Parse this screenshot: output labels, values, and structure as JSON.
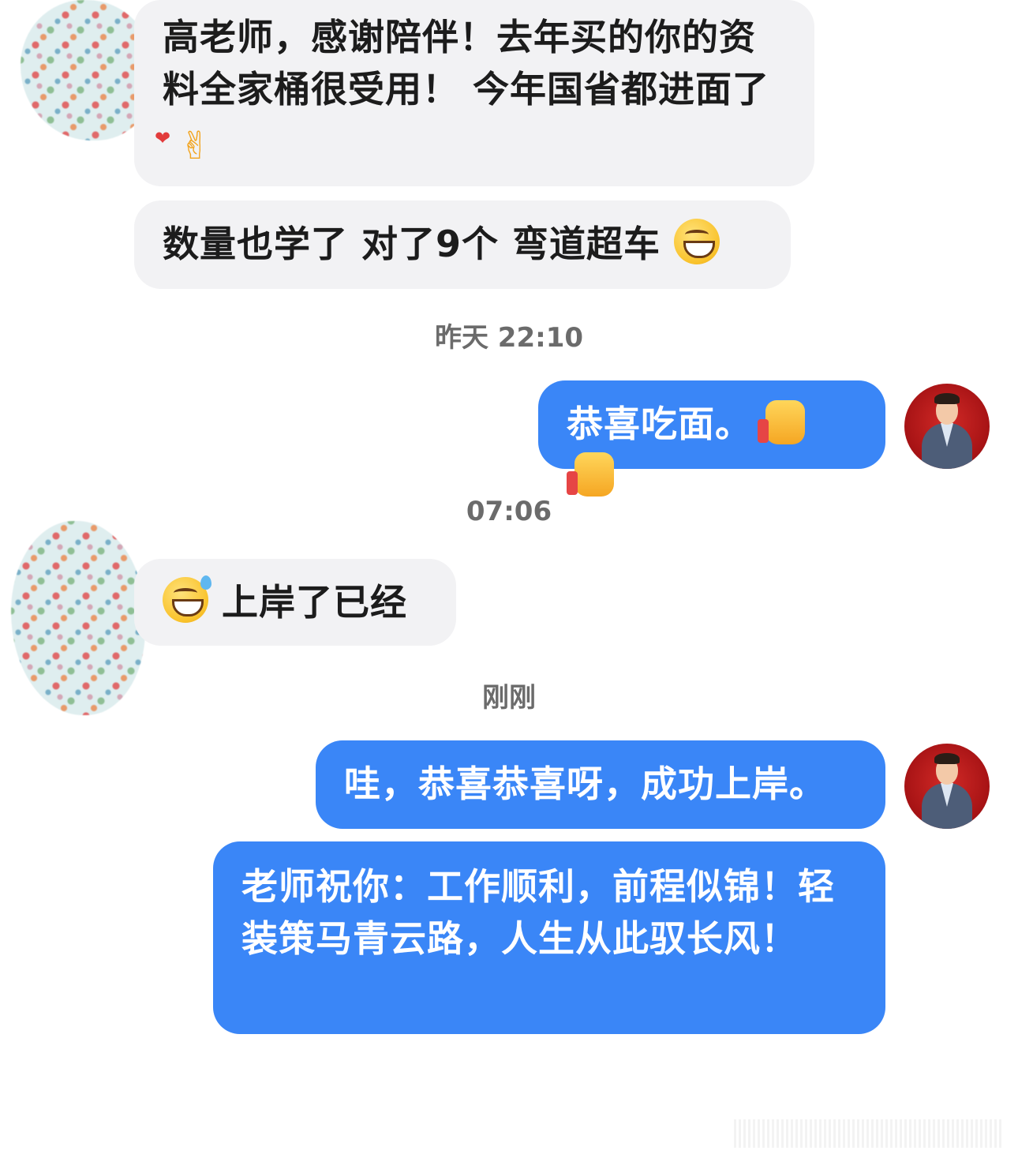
{
  "messages": [
    {
      "from": "student",
      "text": "高老师，感谢陪伴！去年买的你的资料全家桶很受用！ 今年国省都进面了",
      "emoji": "heart-hands-emoji"
    },
    {
      "from": "student",
      "text": "数量也学了 对了9个 弯道超车",
      "emoji": "grin-emoji"
    },
    {
      "from": "teacher",
      "text": "恭喜吃面。",
      "emoji": "thumbs-up-emoji x2"
    },
    {
      "from": "student",
      "text": "上岸了已经",
      "emoji": "sweat-grin-emoji"
    },
    {
      "from": "teacher",
      "text": "哇，恭喜恭喜呀，成功上岸。"
    },
    {
      "from": "teacher",
      "text": "老师祝你：工作顺利，前程似锦！轻装策马青云路，人生从此驭长风！"
    }
  ],
  "timestamps": {
    "t1": "昨天 22:10",
    "t2": "07:06",
    "t3": "刚刚"
  },
  "colors": {
    "incoming_bubble": "#f2f2f4",
    "outgoing_bubble": "#3a86f7",
    "timestamp_text": "#6b6b6b"
  }
}
